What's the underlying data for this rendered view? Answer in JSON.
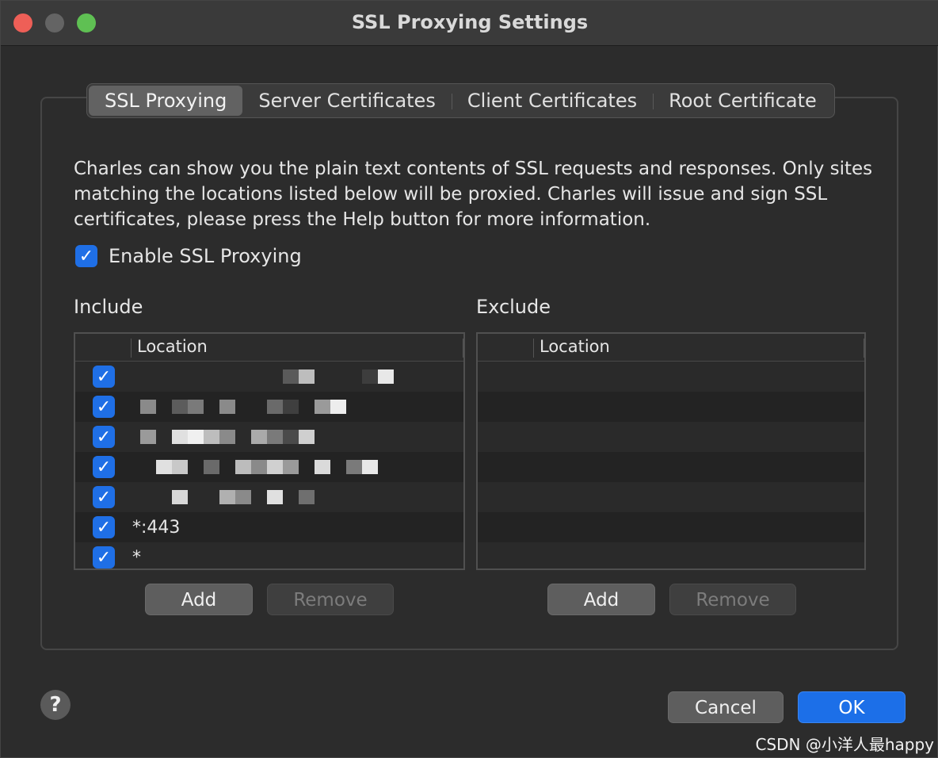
{
  "window": {
    "title": "SSL Proxying Settings"
  },
  "tabs": [
    {
      "label": "SSL Proxying",
      "active": true
    },
    {
      "label": "Server Certificates",
      "active": false
    },
    {
      "label": "Client Certificates",
      "active": false
    },
    {
      "label": "Root Certificate",
      "active": false
    }
  ],
  "description": "Charles can show you the plain text contents of SSL requests and responses. Only sites matching the locations listed below will be proxied. Charles will issue and sign SSL certificates, please press the Help button for more information.",
  "enable": {
    "label": "Enable SSL Proxying",
    "checked": true
  },
  "include": {
    "label": "Include",
    "column": "Location",
    "rows": [
      {
        "checked": true,
        "location": "",
        "redacted": true
      },
      {
        "checked": true,
        "location": "",
        "redacted": true
      },
      {
        "checked": true,
        "location": "",
        "redacted": true
      },
      {
        "checked": true,
        "location": "",
        "redacted": true
      },
      {
        "checked": true,
        "location": "",
        "redacted": true
      },
      {
        "checked": true,
        "location": "*:443",
        "redacted": false
      },
      {
        "checked": true,
        "location": "*",
        "redacted": false
      }
    ],
    "add_label": "Add",
    "remove_label": "Remove"
  },
  "exclude": {
    "label": "Exclude",
    "column": "Location",
    "rows": [],
    "add_label": "Add",
    "remove_label": "Remove"
  },
  "footer": {
    "help_label": "?",
    "cancel_label": "Cancel",
    "ok_label": "OK"
  },
  "watermark": "CSDN @小洋人最happy",
  "colors": {
    "accent": "#1c6fe8",
    "checkbox": "#1f6fe6",
    "close": "#ee5f57",
    "zoom": "#5fc053"
  }
}
